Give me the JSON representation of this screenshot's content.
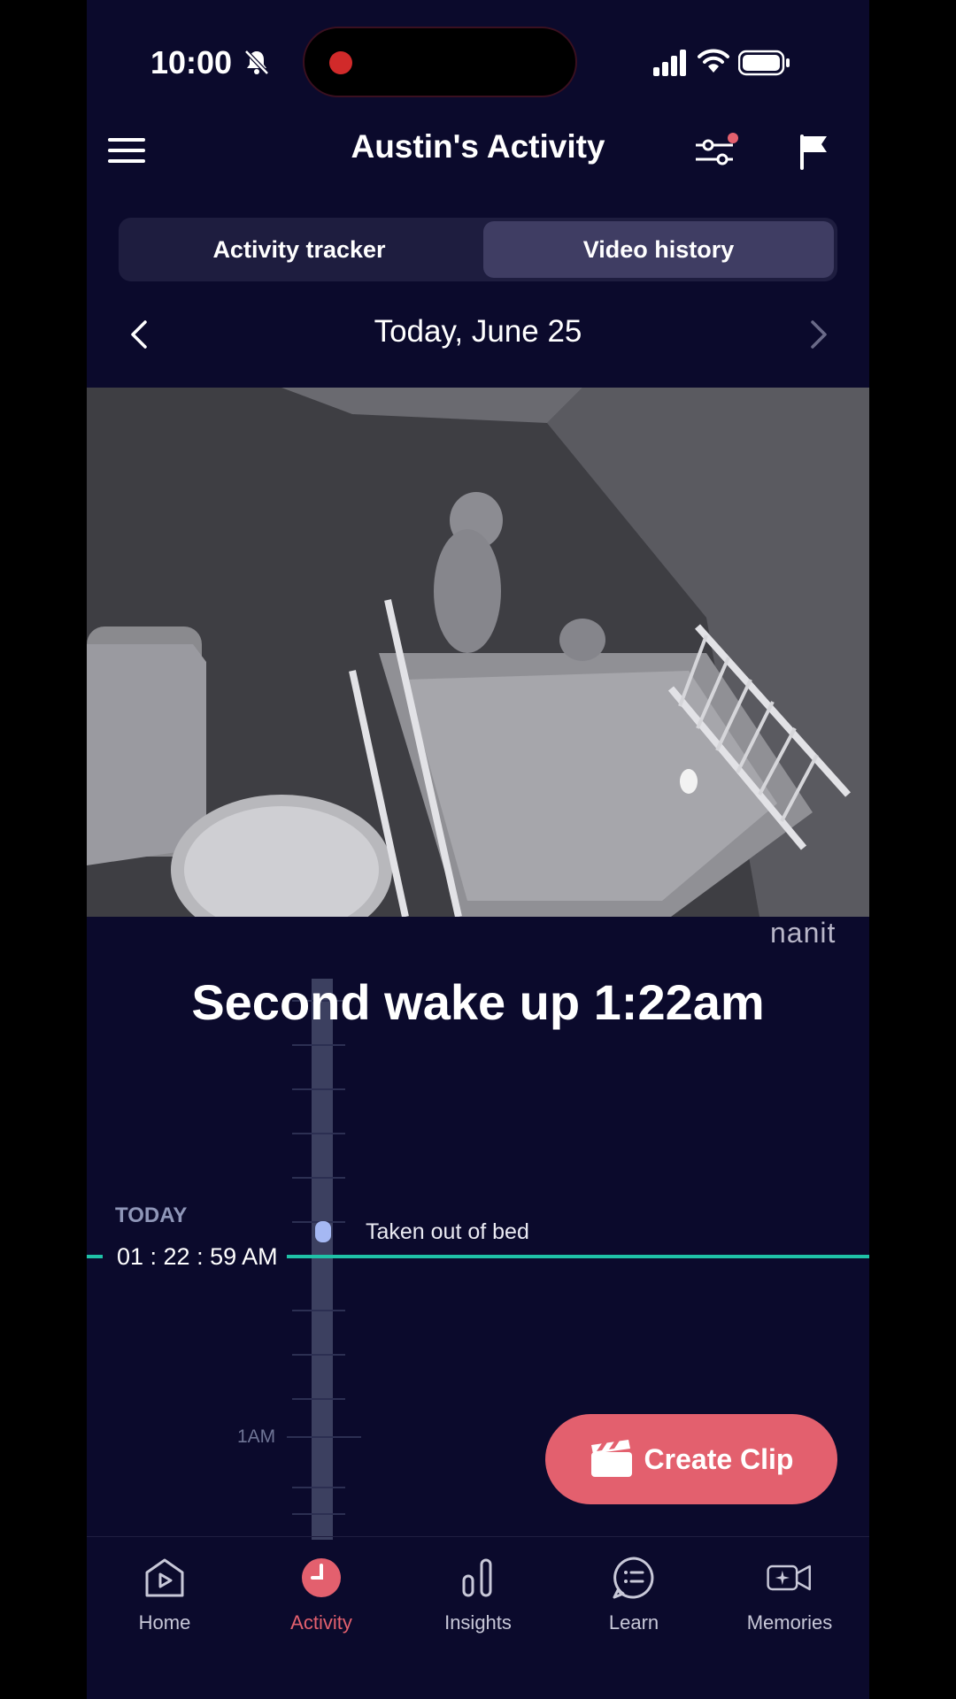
{
  "status_bar": {
    "time": "10:00"
  },
  "header": {
    "title": "Austin's Activity"
  },
  "tabs": [
    {
      "label": "Activity tracker",
      "active": false
    },
    {
      "label": "Video history",
      "active": true
    }
  ],
  "date_nav": {
    "date": "Today, June 25"
  },
  "video": {
    "brand": "nanit"
  },
  "event": {
    "title": "Second wake up 1:22am"
  },
  "timeline": {
    "day_label": "TODAY",
    "current_time": "01 : 22 : 59 AM",
    "event_label": "Taken out of bed",
    "hour_label": "1AM"
  },
  "create_clip": {
    "label": "Create Clip"
  },
  "bottom_nav": {
    "items": [
      {
        "label": "Home",
        "icon": "home-play-icon",
        "active": false
      },
      {
        "label": "Activity",
        "icon": "clock-icon",
        "active": true
      },
      {
        "label": "Insights",
        "icon": "bar-chart-icon",
        "active": false
      },
      {
        "label": "Learn",
        "icon": "chat-list-icon",
        "active": false
      },
      {
        "label": "Memories",
        "icon": "sparkle-camera-icon",
        "active": false
      }
    ]
  },
  "colors": {
    "background": "#0b0a2c",
    "accent": "#e3606e",
    "now_line": "#1fc2a7",
    "tab_active": "#3f3d63"
  }
}
